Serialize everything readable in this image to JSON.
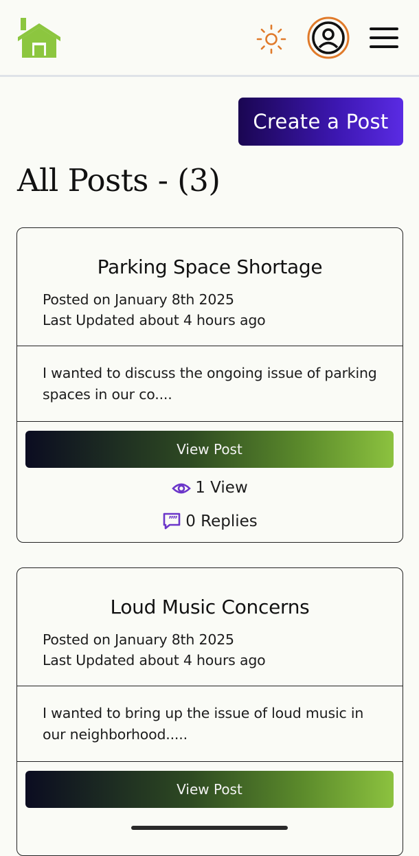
{
  "header": {
    "logo_icon": "house-icon",
    "theme_icon": "sun-icon",
    "profile_icon": "user-circle-icon",
    "menu_icon": "hamburger-menu-icon",
    "logo_color": "#8cc63f",
    "theme_color": "#e07a2a"
  },
  "actions": {
    "create_label": "Create a Post"
  },
  "page": {
    "title": "All Posts - (3)"
  },
  "posts": [
    {
      "title": "Parking Space Shortage",
      "posted": "Posted on January 8th 2025",
      "updated": "Last Updated about 4 hours ago",
      "excerpt_line1": "I wanted to discuss the ongoing issue of parking",
      "excerpt_line2": "spaces in our co....",
      "button": "View Post",
      "views": "1 View",
      "replies": "0 Replies"
    },
    {
      "title": "Loud Music Concerns",
      "posted": "Posted on January 8th 2025",
      "updated": "Last Updated about 4 hours ago",
      "excerpt_line1": "I wanted to bring up the issue of loud music in",
      "excerpt_line2": "our neighborhood.....",
      "button": "View Post"
    }
  ],
  "colors": {
    "accent_purple": "#5b2bd6",
    "icon_purple": "#6b36c9"
  }
}
